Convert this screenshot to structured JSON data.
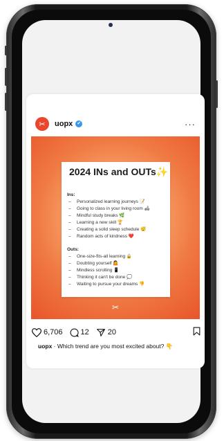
{
  "post": {
    "username": "uopx",
    "more_label": "···",
    "verified_mark": "✔",
    "avatar_glyph": "✂",
    "note": {
      "title": "2024 INs and OUTs✨",
      "ins_label": "Ins:",
      "ins": [
        "Personalized learning journeys 📝",
        "Going to class in your living room 🛋",
        "Mindful study breaks 🌿",
        "Learning a new skill 🏆",
        "Creating a solid sleep schedule 😴",
        "Random acts of kindness ❤️"
      ],
      "outs_label": "Outs:",
      "outs": [
        "One-size-fits-all learning 🔒",
        "Doubting yourself 🤷",
        "Mindless scrolling 📱",
        "Thinking it can't be done 💭",
        "Waiting to pursue your dreams 👎"
      ],
      "dash": "–"
    },
    "likes": "6,706",
    "comments": "12",
    "shares": "20",
    "caption_user": "uopx",
    "caption_text": " · Which trend are you most excited about? 👇"
  },
  "colors": {
    "accent": "#e8462d",
    "verified": "#3897f0",
    "gradient_center": "#ffd3a8",
    "gradient_edge": "#e8552a"
  }
}
